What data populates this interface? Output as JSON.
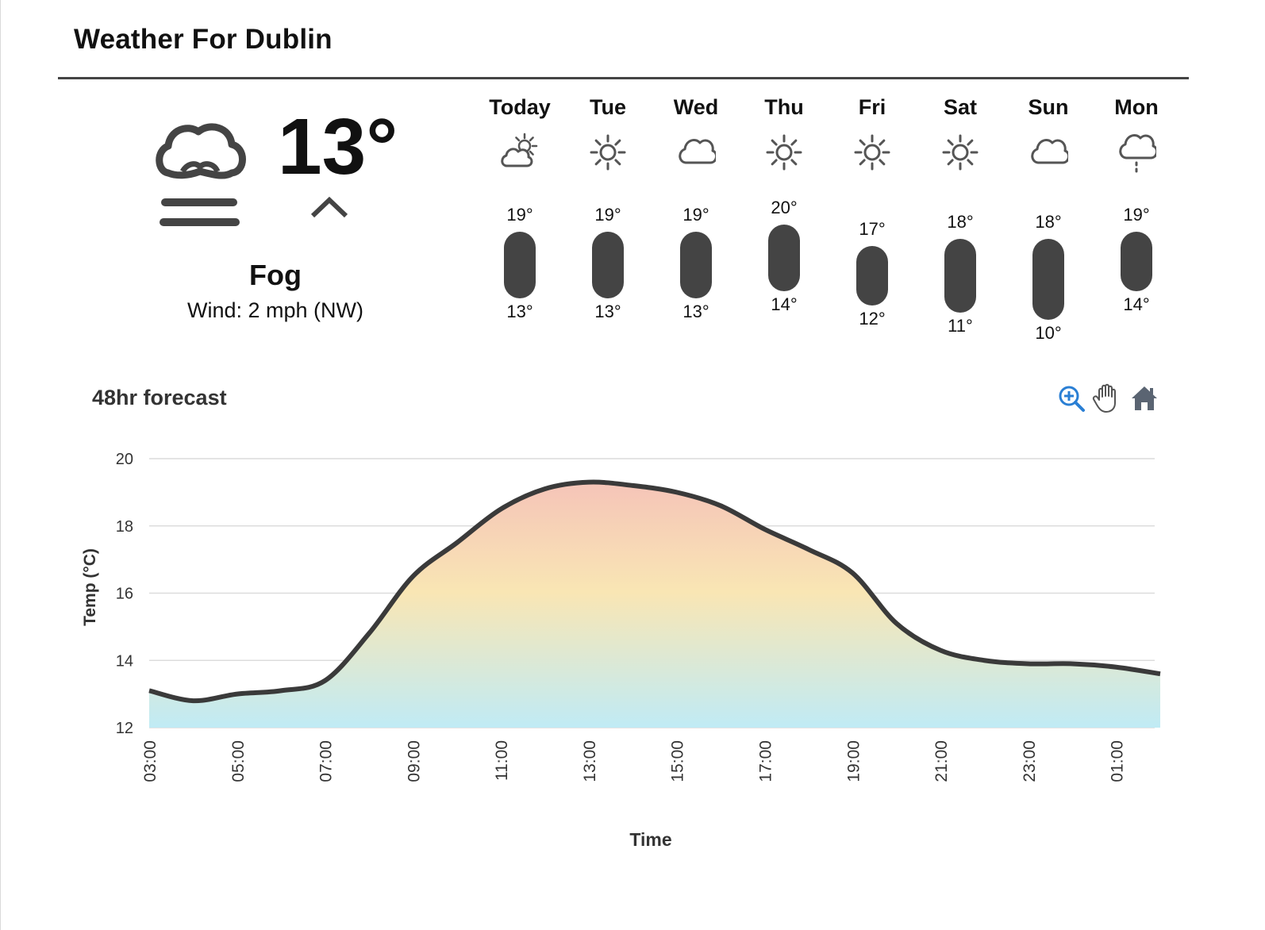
{
  "header": {
    "title": "Weather For Dublin"
  },
  "current": {
    "icon": "fog-icon",
    "temp": "13°",
    "trend": "rising",
    "condition": "Fog",
    "wind": "Wind: 2 mph (NW)"
  },
  "days": [
    {
      "name": "Today",
      "icon": "partly-cloudy-icon",
      "high": "19°",
      "low": "13°",
      "high_val": 19,
      "low_val": 13
    },
    {
      "name": "Tue",
      "icon": "sun-icon",
      "high": "19°",
      "low": "13°",
      "high_val": 19,
      "low_val": 13
    },
    {
      "name": "Wed",
      "icon": "cloud-icon",
      "high": "19°",
      "low": "13°",
      "high_val": 19,
      "low_val": 13
    },
    {
      "name": "Thu",
      "icon": "sun-icon",
      "high": "20°",
      "low": "14°",
      "high_val": 20,
      "low_val": 14
    },
    {
      "name": "Fri",
      "icon": "sun-icon",
      "high": "17°",
      "low": "12°",
      "high_val": 17,
      "low_val": 12
    },
    {
      "name": "Sat",
      "icon": "sun-icon",
      "high": "18°",
      "low": "11°",
      "high_val": 18,
      "low_val": 11
    },
    {
      "name": "Sun",
      "icon": "cloud-icon",
      "high": "18°",
      "low": "10°",
      "high_val": 18,
      "low_val": 10
    },
    {
      "name": "Mon",
      "icon": "drizzle-icon",
      "high": "19°",
      "low": "14°",
      "high_val": 19,
      "low_val": 14
    }
  ],
  "chart_header": {
    "title": "48hr forecast",
    "tools": [
      {
        "icon": "zoom-in-icon",
        "active": true
      },
      {
        "icon": "pan-hand-icon",
        "active": false
      },
      {
        "icon": "home-reset-icon",
        "active": false
      }
    ]
  },
  "chart_data": {
    "type": "area",
    "title": "48hr forecast",
    "xlabel": "Time",
    "ylabel": "Temp (°C)",
    "ylim": [
      12,
      20
    ],
    "yticks": [
      12,
      14,
      16,
      18,
      20
    ],
    "xticks": [
      "03:00",
      "05:00",
      "07:00",
      "09:00",
      "11:00",
      "13:00",
      "15:00",
      "17:00",
      "19:00",
      "21:00",
      "23:00",
      "01:00"
    ],
    "grid": true,
    "x": [
      "03:00",
      "04:00",
      "05:00",
      "06:00",
      "07:00",
      "08:00",
      "09:00",
      "10:00",
      "11:00",
      "12:00",
      "13:00",
      "14:00",
      "15:00",
      "16:00",
      "17:00",
      "18:00",
      "19:00",
      "20:00",
      "21:00",
      "22:00",
      "23:00",
      "00:00",
      "01:00",
      "02:00"
    ],
    "series": [
      {
        "values": [
          13.1,
          12.8,
          13.0,
          13.1,
          13.4,
          14.8,
          16.5,
          17.5,
          18.5,
          19.1,
          19.3,
          19.2,
          19.0,
          18.6,
          17.9,
          17.3,
          16.6,
          15.1,
          14.3,
          14.0,
          13.9,
          13.9,
          13.8,
          13.6
        ]
      }
    ],
    "colors": {
      "line": "#3a3a3a",
      "fill_top": "#f5c4b8",
      "fill_mid": "#f9e6b4",
      "fill_bottom": "#c0ebf5",
      "grid": "#dcdcdc"
    }
  }
}
